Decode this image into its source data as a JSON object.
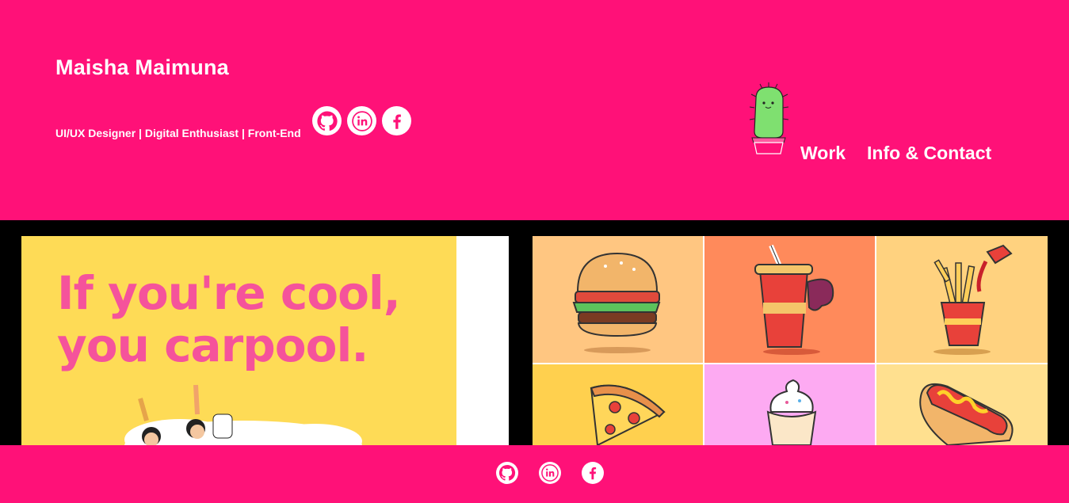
{
  "header": {
    "name": "Maisha Maimuna",
    "tagline": "UI/UX Designer | Digital Enthusiast | Front-End",
    "social": [
      {
        "icon": "github-icon"
      },
      {
        "icon": "linkedin-icon"
      },
      {
        "icon": "facebook-icon"
      }
    ],
    "nav": {
      "work_label": "Work",
      "info_label": "Info & Contact"
    }
  },
  "projects": {
    "carpool_poster": {
      "line1": "If you're cool,",
      "line2": "you carpool."
    },
    "food_icons": [
      "burger",
      "soda-cup",
      "fries-ketchup",
      "pizza-slice",
      "ice-cream",
      "hot-dog"
    ]
  },
  "footer": {
    "social": [
      {
        "icon": "github-icon"
      },
      {
        "icon": "linkedin-icon"
      },
      {
        "icon": "facebook-icon"
      }
    ]
  },
  "colors": {
    "brand_pink": "#ff1178",
    "poster_yellow": "#fedb56",
    "poster_pink_text": "#f5539b",
    "background": "#000000"
  }
}
